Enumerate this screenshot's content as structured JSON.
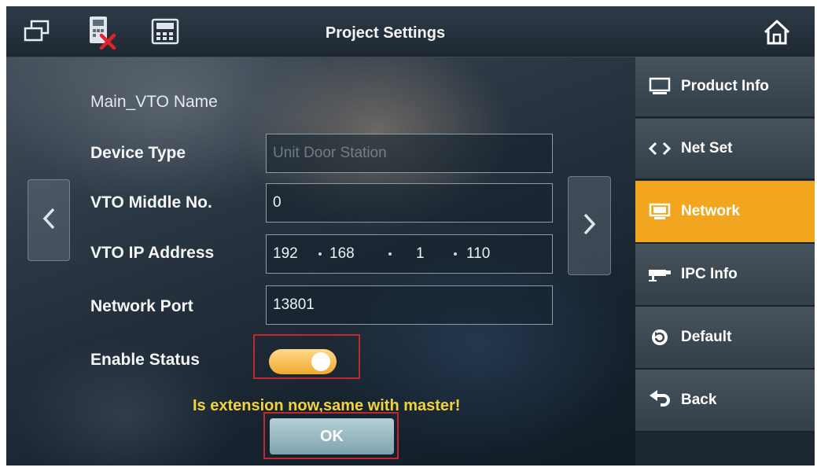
{
  "header": {
    "title": "Project Settings",
    "status_icons": [
      "windows-icon",
      "device-offline-icon",
      "keypad-icon"
    ],
    "home_icon": "home-icon"
  },
  "form": {
    "main_vto_name": {
      "label": "Main_VTO Name"
    },
    "device_type": {
      "label": "Device Type",
      "value": "Unit Door Station"
    },
    "vto_middle_no": {
      "label": "VTO Middle No.",
      "value": "0"
    },
    "vto_ip_address": {
      "label": "VTO IP Address",
      "octets": [
        "192",
        "168",
        "1",
        "110"
      ]
    },
    "network_port": {
      "label": "Network Port",
      "value": "13801"
    },
    "enable_status": {
      "label": "Enable Status",
      "on": true
    }
  },
  "message": "Is extension now,same with master!",
  "ok_button": {
    "label": "OK"
  },
  "pager": {
    "prev_icon": "chevron-left-icon",
    "next_icon": "chevron-right-icon"
  },
  "sidebar": {
    "items": [
      {
        "label": "Product Info",
        "icon": "monitor-icon",
        "active": false
      },
      {
        "label": "Net Set",
        "icon": "code-brackets-icon",
        "active": false
      },
      {
        "label": "Network",
        "icon": "screen-icon",
        "active": true
      },
      {
        "label": "IPC Info",
        "icon": "camera-icon",
        "active": false
      },
      {
        "label": "Default",
        "icon": "reset-icon",
        "active": false
      },
      {
        "label": "Back",
        "icon": "back-arrow-icon",
        "active": false
      }
    ]
  },
  "colors": {
    "accent": "#f2a51e",
    "highlight_box": "#c4262e",
    "message": "#f3d23b"
  }
}
